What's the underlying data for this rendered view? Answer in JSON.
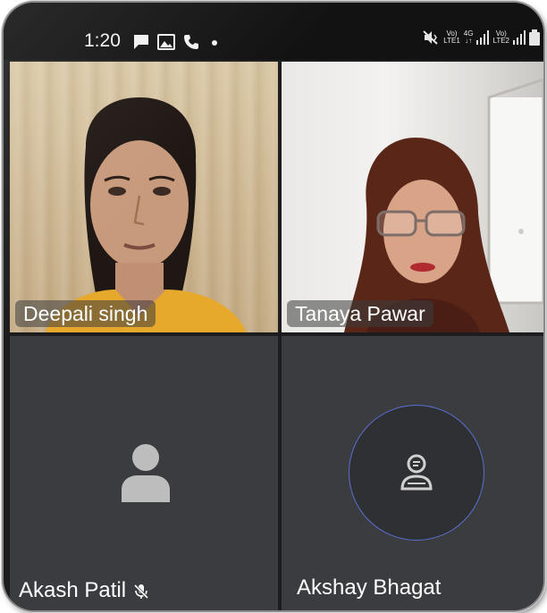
{
  "status_bar": {
    "time": "1:20",
    "left_icons": [
      "chat-icon",
      "image-icon",
      "phone-icon",
      "dot-icon"
    ],
    "right_icons": [
      "mute-vibrate-icon",
      "volte-lte1-icon",
      "4g-arrows-icon",
      "signal-icon",
      "volte-lte2-icon",
      "signal-icon",
      "battery-icon"
    ],
    "volte_label": "Vo)",
    "lte1_label": "LTE1",
    "lte2_label": "LTE2",
    "net_label": "4G"
  },
  "participants": [
    {
      "name": "Deepali singh",
      "video": true
    },
    {
      "name": "Tanaya Pawar",
      "video": true
    },
    {
      "name": "Akash Patil",
      "video": false,
      "muted": true
    },
    {
      "name": "Akshay Bhagat",
      "video": false,
      "speaking": true
    }
  ],
  "colors": {
    "background": "#1d1d1f",
    "tile_off": "#3b3c3f",
    "avatar_grey": "#bdbdbd",
    "speaking_ring": "#5a6fd0"
  }
}
